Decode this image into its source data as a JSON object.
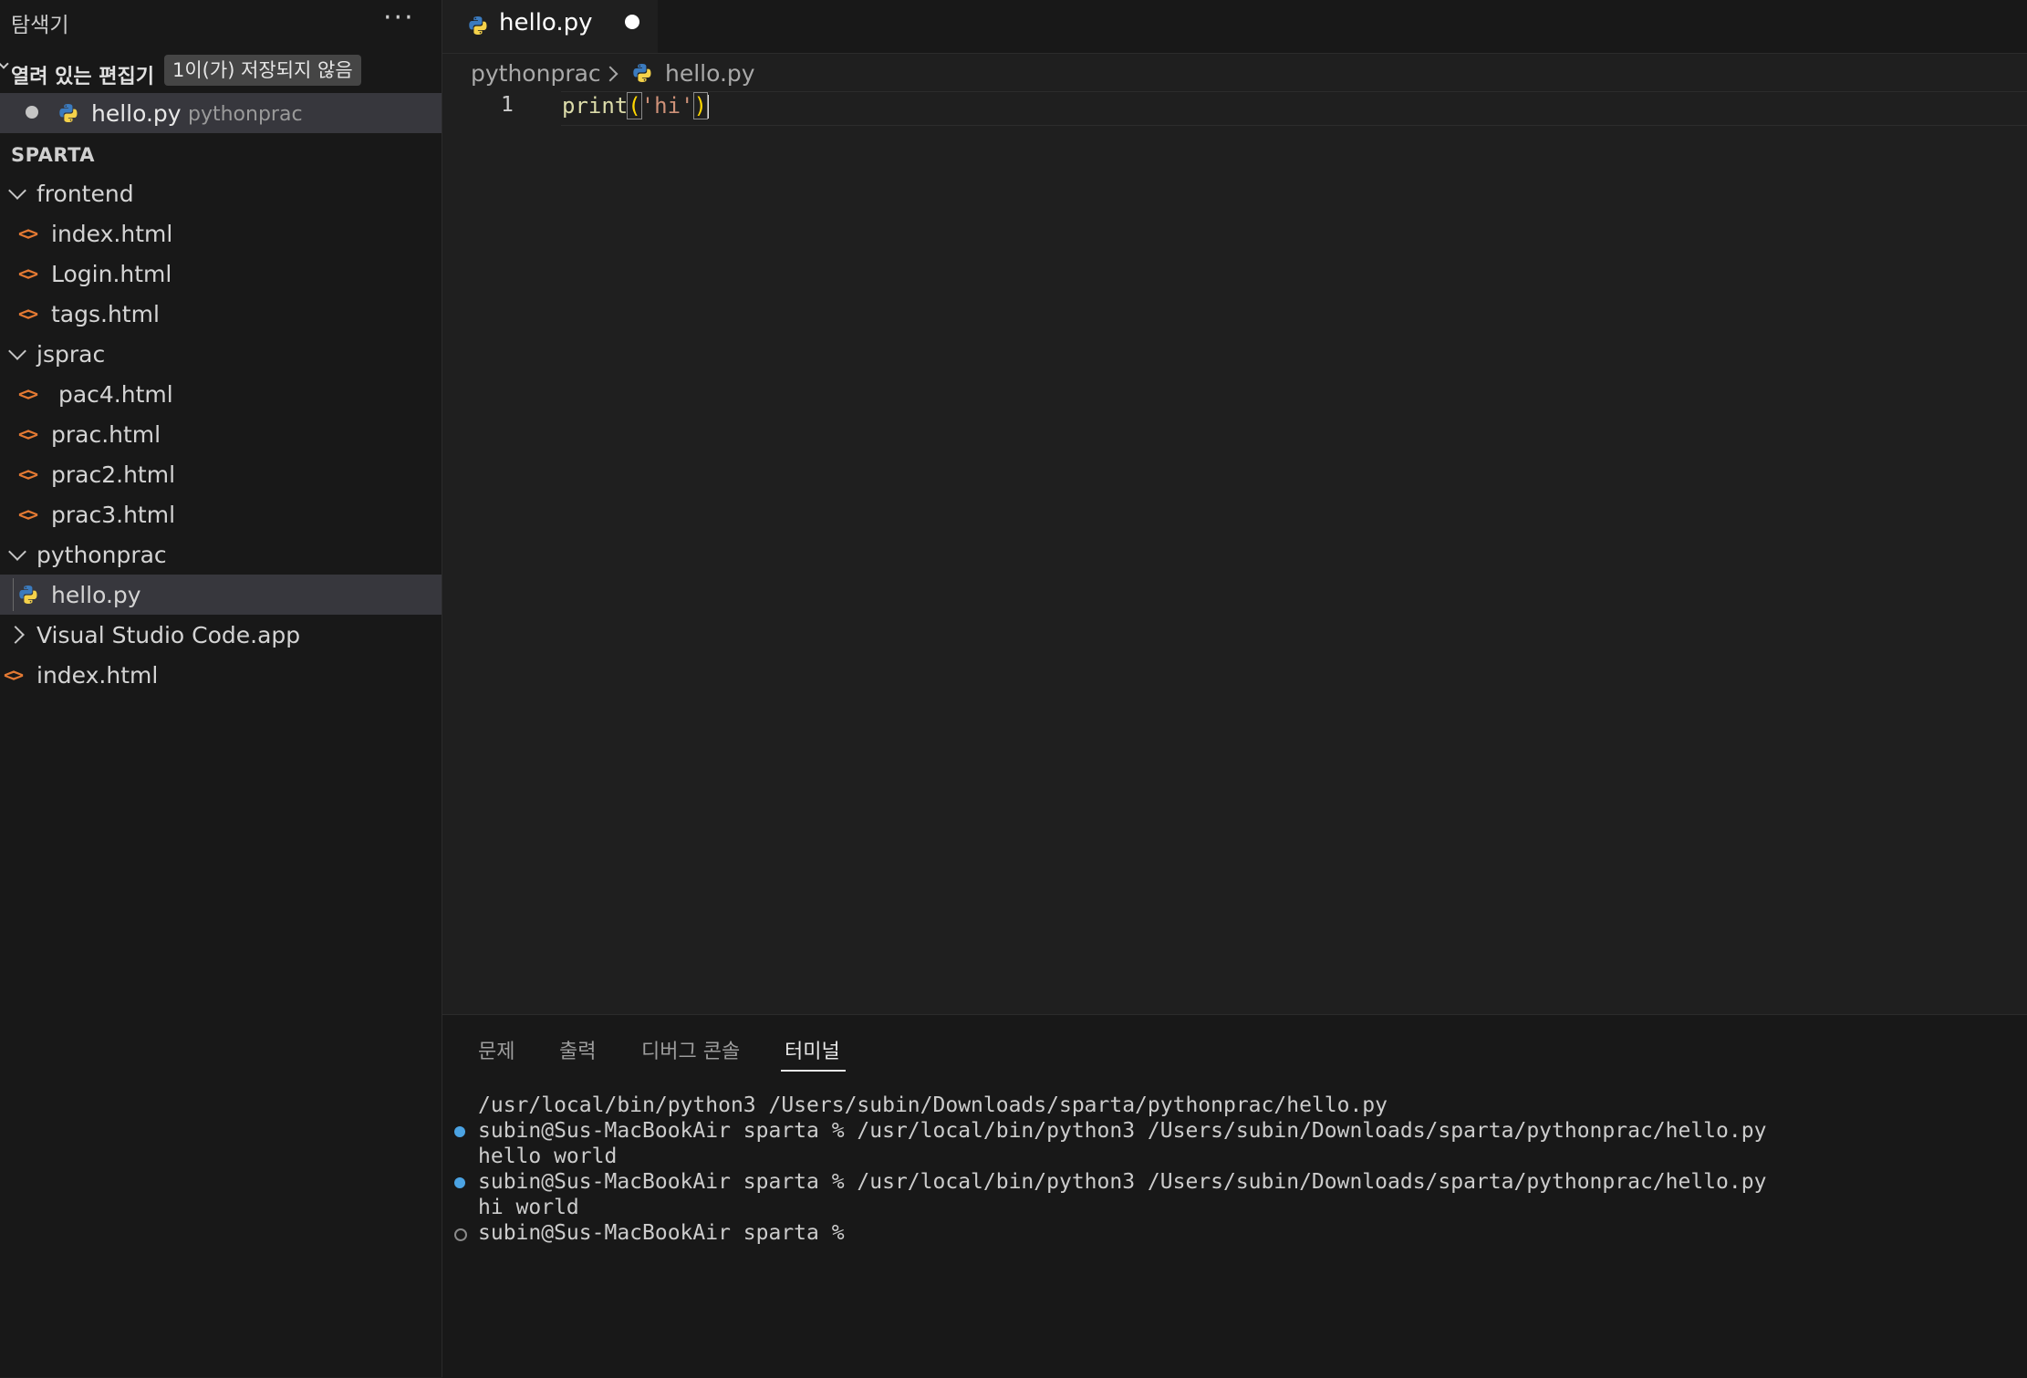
{
  "sidebar": {
    "title": "탐색기",
    "more": "···",
    "open_editors": {
      "title": "열려 있는 편집기",
      "badge": "1이(가) 저장되지 않음",
      "file": {
        "name": "hello.py",
        "folder": "pythonprac"
      }
    },
    "workspace": "SPARTA",
    "tree": {
      "frontend": "frontend",
      "index_html": "index.html",
      "login_html": "Login.html",
      "tags_html": "tags.html",
      "jsprac": "jsprac",
      "pac4_html": " pac4.html",
      "prac_html": "prac.html",
      "prac2_html": "prac2.html",
      "prac3_html": "prac3.html",
      "pythonprac": "pythonprac",
      "hello_py": "hello.py",
      "vscode_app": "Visual Studio Code.app",
      "root_index_html": "index.html"
    },
    "html_icon": "<>"
  },
  "tab": {
    "label": "hello.py",
    "dirty": true
  },
  "breadcrumb": {
    "folder": "pythonprac",
    "file": "hello.py"
  },
  "editor": {
    "line_number": "1",
    "code": {
      "fn": "print",
      "open": "(",
      "str": "'hi'",
      "close": ")"
    }
  },
  "panel": {
    "tabs": [
      "문제",
      "출력",
      "디버그 콘솔",
      "터미널"
    ],
    "active_tab": "터미널",
    "terminal": [
      "/usr/local/bin/python3 /Users/subin/Downloads/sparta/pythonprac/hello.py",
      "subin@Sus-MacBookAir sparta % /usr/local/bin/python3 /Users/subin/Downloads/sparta/pythonprac/hello.py",
      "hello world",
      "subin@Sus-MacBookAir sparta % /usr/local/bin/python3 /Users/subin/Downloads/sparta/pythonprac/hello.py",
      "hi world",
      "subin@Sus-MacBookAir sparta %"
    ]
  },
  "colors": {
    "accent": "#3794ff",
    "html_icon": "#e37933",
    "python_icon": "#3b7bbf"
  }
}
